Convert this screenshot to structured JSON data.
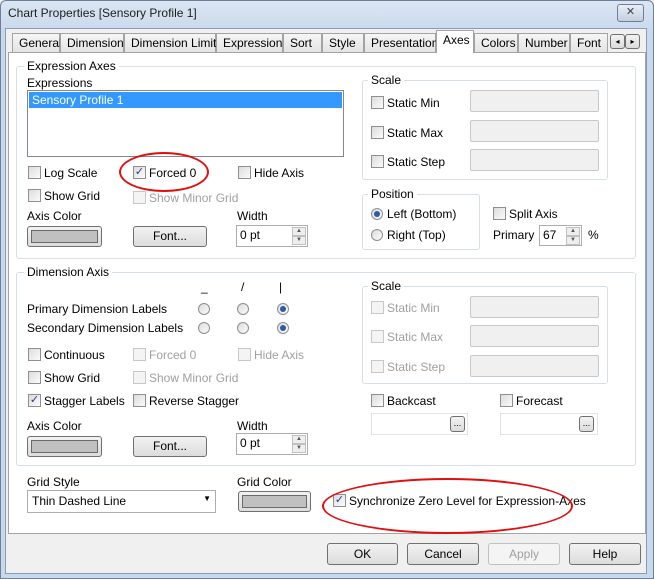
{
  "window": {
    "title": "Chart Properties [Sensory Profile 1]",
    "close": "✕"
  },
  "tabs": [
    "General",
    "Dimensions",
    "Dimension Limits",
    "Expressions",
    "Sort",
    "Style",
    "Presentation",
    "Axes",
    "Colors",
    "Number",
    "Font"
  ],
  "tab_scroll": {
    "left": "◂",
    "right": "▸"
  },
  "expression_axes": {
    "legend": "Expression Axes",
    "expressions_label": "Expressions",
    "expressions": [
      "Sensory Profile 1"
    ],
    "log_scale": {
      "label": "Log Scale",
      "checked": false
    },
    "forced_0": {
      "label": "Forced 0",
      "checked": true
    },
    "hide_axis": {
      "label": "Hide Axis",
      "checked": false
    },
    "show_grid": {
      "label": "Show Grid",
      "checked": false
    },
    "show_minor_grid": {
      "label": "Show Minor Grid",
      "checked": false
    },
    "axis_color_label": "Axis Color",
    "font_button": "Font...",
    "width_label": "Width",
    "width_value": "0 pt",
    "scale": {
      "legend": "Scale",
      "static_min": "Static Min",
      "static_max": "Static Max",
      "static_step": "Static Step"
    },
    "position": {
      "legend": "Position",
      "left": "Left (Bottom)",
      "right": "Right (Top)",
      "selected": "left"
    },
    "split_axis": {
      "label": "Split Axis",
      "checked": false
    },
    "primary_label": "Primary",
    "primary_value": "67",
    "percent": "%"
  },
  "dimension_axis": {
    "legend": "Dimension Axis",
    "headers": [
      "_",
      "/",
      "|"
    ],
    "primary_labels": "Primary Dimension Labels",
    "secondary_labels": "Secondary Dimension Labels",
    "continuous": "Continuous",
    "forced_0": "Forced 0",
    "hide_axis": "Hide Axis",
    "show_grid": "Show Grid",
    "show_minor_grid": "Show Minor Grid",
    "stagger_labels": {
      "label": "Stagger Labels",
      "checked": true
    },
    "reverse_stagger": "Reverse Stagger",
    "axis_color_label": "Axis Color",
    "font_button": "Font...",
    "width_label": "Width",
    "width_value": "0 pt",
    "scale": {
      "legend": "Scale",
      "static_min": "Static Min",
      "static_max": "Static Max",
      "static_step": "Static Step"
    },
    "backcast": "Backcast",
    "forecast": "Forecast",
    "ellipsis": "..."
  },
  "grid_style_label": "Grid Style",
  "grid_style_value": "Thin Dashed Line",
  "grid_color_label": "Grid Color",
  "sync_zero": {
    "label": "Synchronize Zero Level for Expression-Axes",
    "checked": true
  },
  "buttons": {
    "ok": "OK",
    "cancel": "Cancel",
    "apply": "Apply",
    "help": "Help"
  }
}
